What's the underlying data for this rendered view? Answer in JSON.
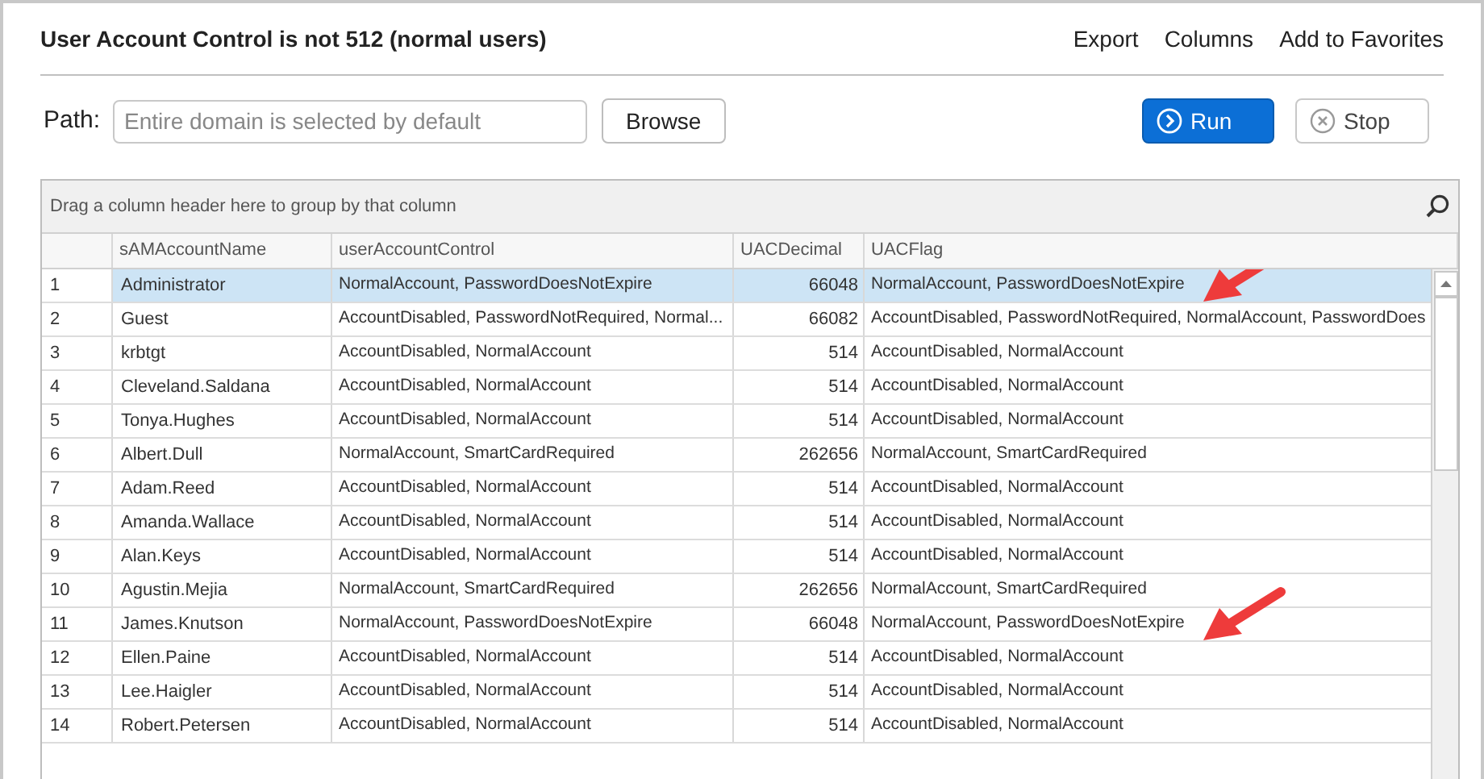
{
  "title": "User Account Control is not 512 (normal users)",
  "header_links": [
    "Export",
    "Columns",
    "Add to Favorites"
  ],
  "path": {
    "label": "Path:",
    "placeholder": "Entire domain is selected by default",
    "browse": "Browse"
  },
  "actions": [
    {
      "label": "Run",
      "kind": "primary"
    },
    {
      "label": "Stop",
      "kind": "secondary"
    }
  ],
  "table": {
    "group_hint": "Drag a column header here to group by that column",
    "columns": [
      "sAMAccountName",
      "userAccountControl",
      "UACDecimal",
      "UACFlag"
    ],
    "rows": [
      {
        "n": "1",
        "name": "Administrator",
        "uac": "NormalAccount, PasswordDoesNotExpire",
        "dec": "66048",
        "flag": "NormalAccount, PasswordDoesNotExpire",
        "selected": true,
        "arrow": true
      },
      {
        "n": "2",
        "name": "Guest",
        "uac": "AccountDisabled, PasswordNotRequired, Normal...",
        "dec": "66082",
        "flag": "AccountDisabled, PasswordNotRequired, NormalAccount, PasswordDoes",
        "selected": false,
        "arrow": false
      },
      {
        "n": "3",
        "name": "krbtgt",
        "uac": "AccountDisabled, NormalAccount",
        "dec": "514",
        "flag": "AccountDisabled, NormalAccount",
        "selected": false,
        "arrow": false
      },
      {
        "n": "4",
        "name": "Cleveland.Saldana",
        "uac": "AccountDisabled, NormalAccount",
        "dec": "514",
        "flag": "AccountDisabled, NormalAccount",
        "selected": false,
        "arrow": false
      },
      {
        "n": "5",
        "name": "Tonya.Hughes",
        "uac": "AccountDisabled, NormalAccount",
        "dec": "514",
        "flag": "AccountDisabled, NormalAccount",
        "selected": false,
        "arrow": false
      },
      {
        "n": "6",
        "name": "Albert.Dull",
        "uac": "NormalAccount, SmartCardRequired",
        "dec": "262656",
        "flag": "NormalAccount, SmartCardRequired",
        "selected": false,
        "arrow": false
      },
      {
        "n": "7",
        "name": "Adam.Reed",
        "uac": "AccountDisabled, NormalAccount",
        "dec": "514",
        "flag": "AccountDisabled, NormalAccount",
        "selected": false,
        "arrow": false
      },
      {
        "n": "8",
        "name": "Amanda.Wallace",
        "uac": "AccountDisabled, NormalAccount",
        "dec": "514",
        "flag": "AccountDisabled, NormalAccount",
        "selected": false,
        "arrow": false
      },
      {
        "n": "9",
        "name": "Alan.Keys",
        "uac": "AccountDisabled, NormalAccount",
        "dec": "514",
        "flag": "AccountDisabled, NormalAccount",
        "selected": false,
        "arrow": false
      },
      {
        "n": "10",
        "name": "Agustin.Mejia",
        "uac": "NormalAccount, SmartCardRequired",
        "dec": "262656",
        "flag": "NormalAccount, SmartCardRequired",
        "selected": false,
        "arrow": false
      },
      {
        "n": "11",
        "name": "James.Knutson",
        "uac": "NormalAccount, PasswordDoesNotExpire",
        "dec": "66048",
        "flag": "NormalAccount, PasswordDoesNotExpire",
        "selected": false,
        "arrow": true
      },
      {
        "n": "12",
        "name": "Ellen.Paine",
        "uac": "AccountDisabled, NormalAccount",
        "dec": "514",
        "flag": "AccountDisabled, NormalAccount",
        "selected": false,
        "arrow": false
      },
      {
        "n": "13",
        "name": "Lee.Haigler",
        "uac": "AccountDisabled, NormalAccount",
        "dec": "514",
        "flag": "AccountDisabled, NormalAccount",
        "selected": false,
        "arrow": false
      },
      {
        "n": "14",
        "name": "Robert.Petersen",
        "uac": "AccountDisabled, NormalAccount",
        "dec": "514",
        "flag": "AccountDisabled, NormalAccount",
        "selected": false,
        "arrow": false
      }
    ]
  }
}
